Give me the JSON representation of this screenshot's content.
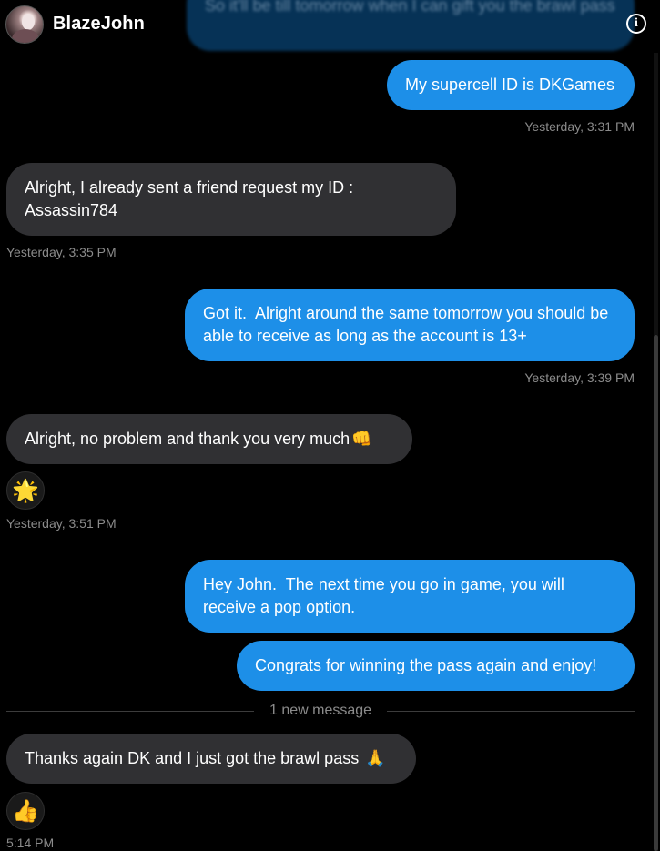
{
  "header": {
    "contact_name": "BlazeJohn",
    "info_icon": "info-icon"
  },
  "faded_top_message": "So it'll be till tomorrow when I can gift you the brawl pass",
  "messages": [
    {
      "id": "m1",
      "direction": "out",
      "text": "My supercell ID is DKGames",
      "timestamp": "Yesterday, 3:31 PM"
    },
    {
      "id": "m2",
      "direction": "in",
      "text": "Alright, I already sent a friend request my ID : Assassin784",
      "timestamp": "Yesterday, 3:35 PM"
    },
    {
      "id": "m3",
      "direction": "out",
      "text": "Got it.  Alright around the same tomorrow you should be able to receive as long as the account is 13+",
      "timestamp": "Yesterday, 3:39 PM"
    },
    {
      "id": "m4",
      "direction": "in",
      "text": "Alright, no problem and thank you very much",
      "emoji": "👊",
      "reaction": "🌟",
      "timestamp": "Yesterday, 3:51 PM"
    },
    {
      "id": "m5",
      "direction": "out",
      "text": "Hey John.  The next time you go in game, you will receive a pop option."
    },
    {
      "id": "m6",
      "direction": "out",
      "text": "Congrats for winning the pass again and enjoy!"
    },
    {
      "id": "m7",
      "direction": "in",
      "text": "Thanks again DK and I just got the brawl pass ",
      "emoji": "🙏",
      "reaction": "👍",
      "timestamp": "5:14 PM"
    }
  ],
  "divider": {
    "label": "1 new message"
  },
  "colors": {
    "background": "#000000",
    "outgoing_bubble": "#1d8fe8",
    "incoming_bubble": "#303033",
    "timestamp": "#8b8b8b"
  }
}
